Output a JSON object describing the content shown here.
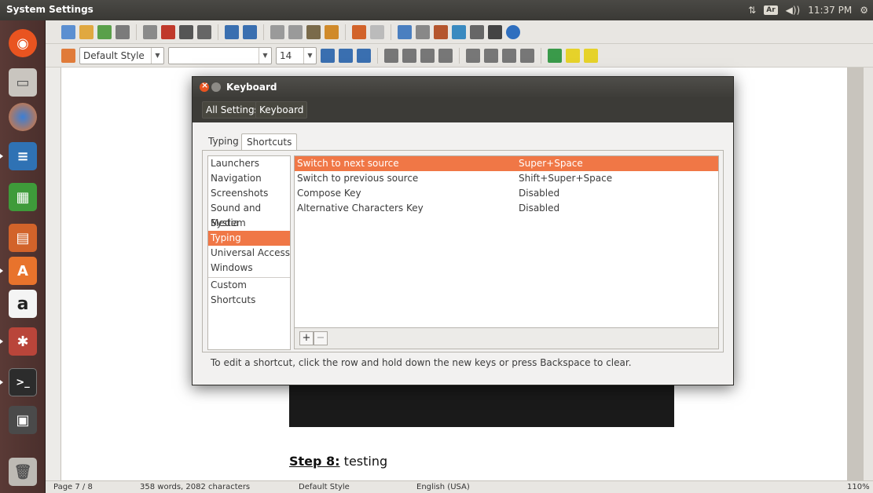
{
  "top_panel": {
    "title": "System Settings",
    "keyboard_indicator": "Ar",
    "time": "11:37 PM"
  },
  "launcher": {
    "items": [
      "dash",
      "files",
      "firefox",
      "writer",
      "calc",
      "impress",
      "software-center",
      "amazon",
      "system-settings",
      "terminal",
      "save",
      "trash"
    ]
  },
  "writer": {
    "paragraph_style": "Default Style",
    "font_name": "",
    "font_size": "14",
    "step_label": "Step 8:",
    "step_text": " testing",
    "status": {
      "page": "Page 7 / 8",
      "words": "358 words, 2082 characters",
      "style": "Default Style",
      "language": "English (USA)",
      "zoom": "110%"
    }
  },
  "dialog": {
    "title": "Keyboard",
    "breadcrumbs": [
      "All Settings",
      "Keyboard"
    ],
    "tabs": [
      "Typing",
      "Shortcuts"
    ],
    "active_tab": "Shortcuts",
    "categories": [
      "Launchers",
      "Navigation",
      "Screenshots",
      "Sound and Media",
      "System",
      "Typing",
      "Universal Access",
      "Windows",
      "Custom Shortcuts"
    ],
    "selected_category": "Typing",
    "shortcuts": [
      {
        "name": "Switch to next source",
        "accel": "Super+Space"
      },
      {
        "name": "Switch to previous source",
        "accel": "Shift+Super+Space"
      },
      {
        "name": "Compose Key",
        "accel": "Disabled"
      },
      {
        "name": "Alternative Characters Key",
        "accel": "Disabled"
      }
    ],
    "selected_shortcut": 0,
    "add_label": "+",
    "remove_label": "−",
    "hint": "To edit a shortcut, click the row and hold down the new keys or press Backspace to clear."
  }
}
